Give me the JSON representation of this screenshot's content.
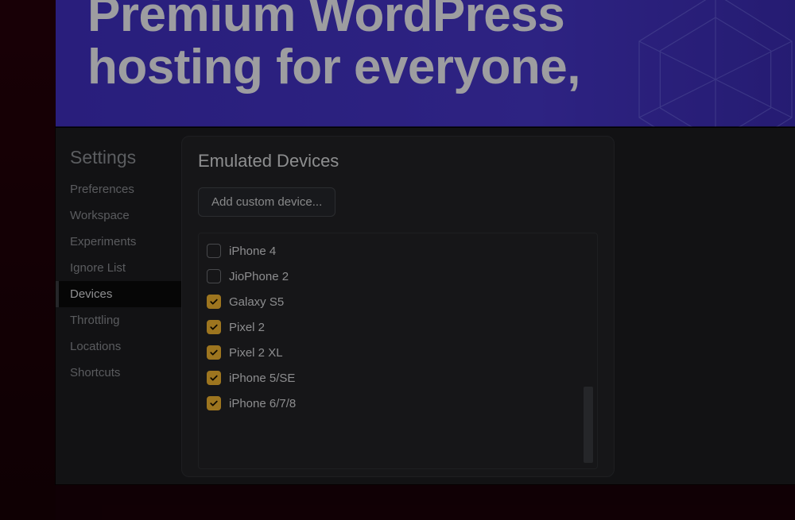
{
  "hero": {
    "line1": "Premium WordPress",
    "line2": "hosting for everyone,"
  },
  "sidebar": {
    "title": "Settings",
    "items": [
      {
        "label": "Preferences",
        "active": false
      },
      {
        "label": "Workspace",
        "active": false
      },
      {
        "label": "Experiments",
        "active": false
      },
      {
        "label": "Ignore List",
        "active": false
      },
      {
        "label": "Devices",
        "active": true
      },
      {
        "label": "Throttling",
        "active": false
      },
      {
        "label": "Locations",
        "active": false
      },
      {
        "label": "Shortcuts",
        "active": false
      }
    ]
  },
  "content": {
    "title": "Emulated Devices",
    "add_button_label": "Add custom device...",
    "devices": [
      {
        "label": "iPhone 4",
        "checked": false
      },
      {
        "label": "JioPhone 2",
        "checked": false
      },
      {
        "label": "Galaxy S5",
        "checked": true
      },
      {
        "label": "Pixel 2",
        "checked": true
      },
      {
        "label": "Pixel 2 XL",
        "checked": true
      },
      {
        "label": "iPhone 5/SE",
        "checked": true
      },
      {
        "label": "iPhone 6/7/8",
        "checked": true
      }
    ]
  },
  "colors": {
    "accent_checkbox": "#f2b431",
    "panel_bg": "#1c1d20",
    "card_bg": "#222326",
    "hero_bg": "#4636c8"
  }
}
